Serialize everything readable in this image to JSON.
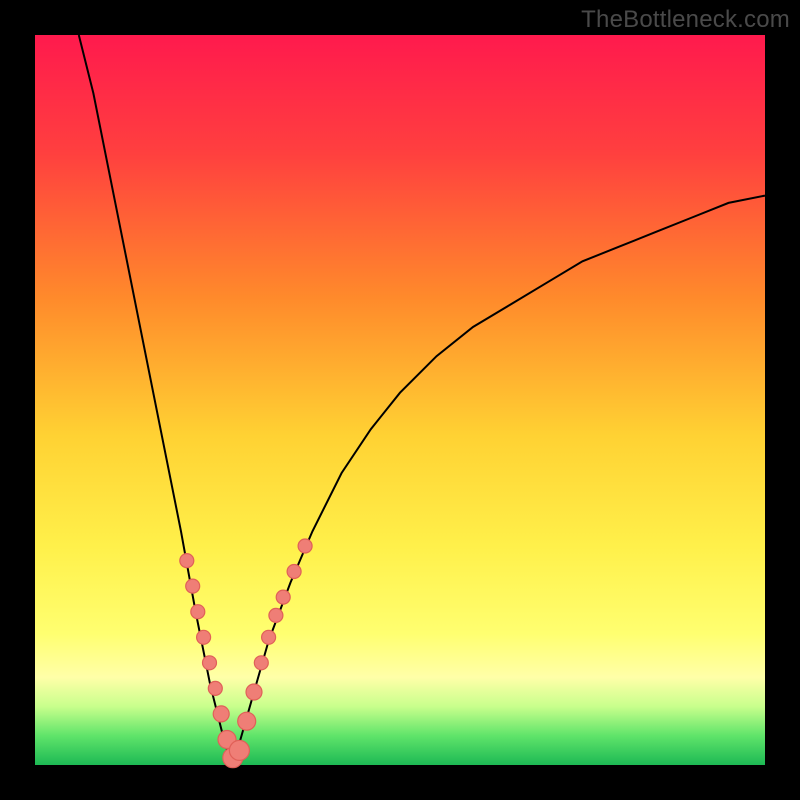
{
  "watermark": "TheBottleneck.com",
  "colors": {
    "gradient_stops": [
      {
        "pct": 0,
        "hex": "#ff1a4d"
      },
      {
        "pct": 16,
        "hex": "#ff3f3f"
      },
      {
        "pct": 36,
        "hex": "#ff8a2b"
      },
      {
        "pct": 55,
        "hex": "#ffd233"
      },
      {
        "pct": 70,
        "hex": "#fff04a"
      },
      {
        "pct": 82,
        "hex": "#ffff70"
      },
      {
        "pct": 88,
        "hex": "#ffffa8"
      },
      {
        "pct": 92,
        "hex": "#c8ff8c"
      },
      {
        "pct": 96,
        "hex": "#5fe46a"
      },
      {
        "pct": 100,
        "hex": "#1db954"
      }
    ],
    "dot_fill": "#ef7e76",
    "dot_stroke": "#e06058",
    "curve": "#000000",
    "frame": "#000000"
  },
  "chart_data": {
    "type": "line",
    "title": "",
    "xlabel": "",
    "ylabel": "",
    "xlim": [
      0,
      100
    ],
    "ylim": [
      0,
      100
    ],
    "grid": false,
    "legend": false,
    "notes": "V-shaped bottleneck curve; minimum (~0) at x≈27%; left branch goes off top; right branch rises to ~78% at x=100.",
    "series": [
      {
        "name": "curve-left",
        "x": [
          6,
          8,
          10,
          12,
          14,
          16,
          18,
          20,
          22,
          24,
          25,
          26,
          27
        ],
        "y": [
          100,
          92,
          82,
          72,
          62,
          52,
          42,
          32,
          21,
          11,
          7,
          3,
          0
        ]
      },
      {
        "name": "curve-right",
        "x": [
          27,
          28,
          30,
          32,
          35,
          38,
          42,
          46,
          50,
          55,
          60,
          65,
          70,
          75,
          80,
          85,
          90,
          95,
          100
        ],
        "y": [
          0,
          3,
          10,
          17,
          25,
          32,
          40,
          46,
          51,
          56,
          60,
          63,
          66,
          69,
          71,
          73,
          75,
          77,
          78
        ]
      }
    ],
    "dots": {
      "name": "sample-points",
      "x": [
        20.8,
        21.6,
        22.3,
        23.1,
        23.9,
        24.7,
        25.5,
        26.3,
        27.1,
        28.0,
        29.0,
        30.0,
        31.0,
        32.0,
        33.0,
        34.0,
        35.5,
        37.0
      ],
      "y": [
        28.0,
        24.5,
        21.0,
        17.5,
        14.0,
        10.5,
        7.0,
        3.5,
        1.0,
        2.0,
        6.0,
        10.0,
        14.0,
        17.5,
        20.5,
        23.0,
        26.5,
        30.0
      ],
      "r": [
        7,
        7,
        7,
        7,
        7,
        7,
        8,
        9,
        10,
        10,
        9,
        8,
        7,
        7,
        7,
        7,
        7,
        7
      ]
    }
  }
}
